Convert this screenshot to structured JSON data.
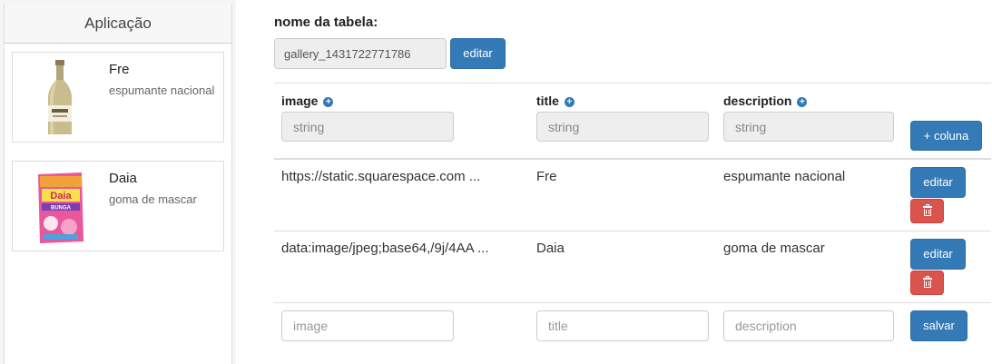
{
  "sidebar": {
    "title": "Aplicação",
    "items": [
      {
        "title": "Fre",
        "subtitle": "espumante nacional",
        "thumb": "sparkling-wine-bottle-image"
      },
      {
        "title": "Daia",
        "subtitle": "goma de mascar",
        "thumb": "daia-bunga-gum-package-image"
      }
    ]
  },
  "table": {
    "name_label": "nome da tabela:",
    "name_value": "gallery_1431722771786",
    "edit_label": "editar"
  },
  "columns": [
    {
      "name": "image",
      "type": "string"
    },
    {
      "name": "title",
      "type": "string"
    },
    {
      "name": "description",
      "type": "string"
    }
  ],
  "add_column_label": "+ coluna",
  "rows": [
    {
      "image": "https://static.squarespace.com ...",
      "title": "Fre",
      "description": "espumante nacional",
      "edit_label": "editar"
    },
    {
      "image": "data:image/jpeg;base64,/9j/4AA ...",
      "title": "Daia",
      "description": "goma de mascar",
      "edit_label": "editar"
    }
  ],
  "new_row": {
    "image_placeholder": "image",
    "title_placeholder": "title",
    "description_placeholder": "description",
    "save_label": "salvar"
  },
  "colors": {
    "primary": "#337ab7",
    "danger": "#d9534f"
  }
}
